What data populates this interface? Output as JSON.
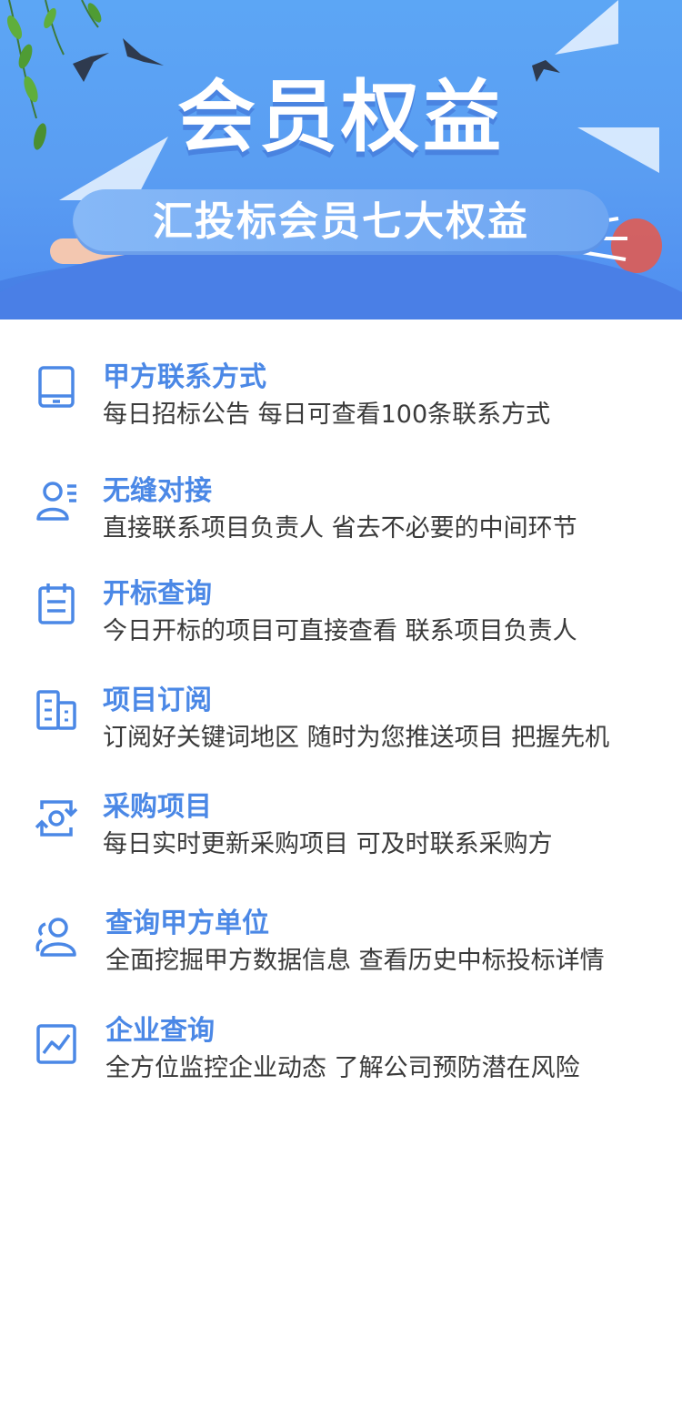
{
  "banner": {
    "title": "会员权益",
    "subtitle": "汇投标会员七大权益"
  },
  "colors": {
    "accent": "#4b88e6",
    "banner_bg": "#5ca6f5",
    "text": "#3a3a3a"
  },
  "benefits": [
    {
      "icon": "tablet-icon",
      "title": "甲方联系方式",
      "desc": "每日招标公告  每日可查看100条联系方式"
    },
    {
      "icon": "user-list-icon",
      "title": "无缝对接",
      "desc": "直接联系项目负责人  省去不必要的中间环节"
    },
    {
      "icon": "calendar-icon",
      "title": "开标查询",
      "desc": "今日开标的项目可直接查看   联系项目负责人"
    },
    {
      "icon": "building-icon",
      "title": "项目订阅",
      "desc": "订阅好关键词地区  随时为您推送项目  把握先机"
    },
    {
      "icon": "refresh-camera-icon",
      "title": "采购项目",
      "desc": "每日实时更新采购项目  可及时联系采购方"
    },
    {
      "icon": "users-icon",
      "title": "查询甲方单位",
      "desc": "全面挖掘甲方数据信息  查看历史中标投标详情"
    },
    {
      "icon": "trend-chart-icon",
      "title": "企业查询",
      "desc": "全方位监控企业动态  了解公司预防潜在风险"
    }
  ]
}
